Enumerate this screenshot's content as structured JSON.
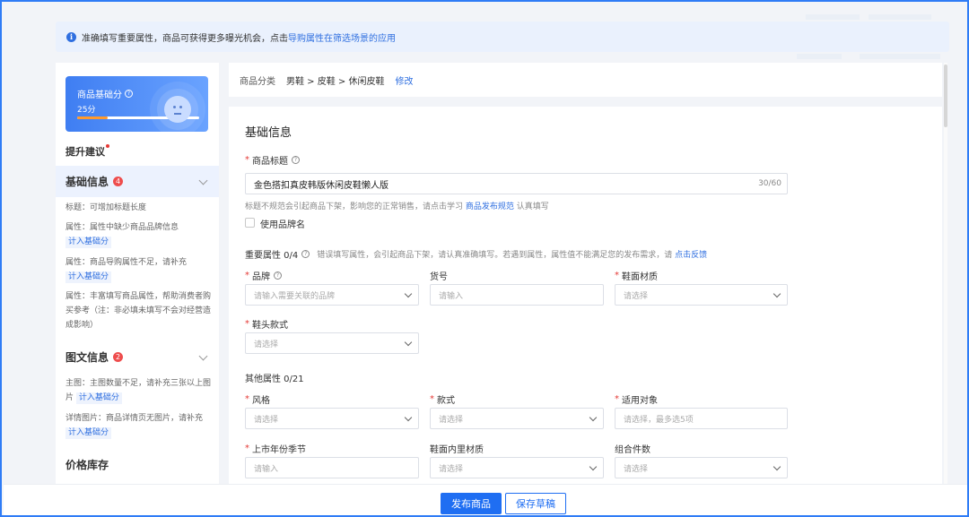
{
  "notice": {
    "text": "准确填写重要属性，商品可获得更多曝光机会，点击",
    "link": "导购属性在筛选场景的应用"
  },
  "sidebar": {
    "score_title": "商品基础分",
    "score_value": "25分",
    "score_progress": 0.25,
    "suggest_label": "提升建议",
    "sections": [
      {
        "title": "基础信息",
        "badge": "4",
        "items": [
          {
            "text": "标题：可增加标题长度"
          },
          {
            "text": "属性：属性中缺少商品品牌信息",
            "tag": "计入基础分"
          },
          {
            "text": "属性：商品导购属性不足，请补充",
            "tag": "计入基础分"
          },
          {
            "text": "属性：丰富填写商品属性，帮助消费者购买参考（注：非必填未填写不会对经营造成影响）"
          }
        ]
      },
      {
        "title": "图文信息",
        "badge": "2",
        "items": [
          {
            "text": "主图：主图数量不足，请补充三张以上图片",
            "tag": "计入基础分"
          },
          {
            "text": "详情图片：商品详情页无图片，请补充",
            "tag": "计入基础分"
          }
        ]
      },
      {
        "title": "价格库存"
      }
    ]
  },
  "category": {
    "label": "商品分类",
    "path": "男鞋 > 皮鞋 > 休闲皮鞋",
    "edit": "修改"
  },
  "form": {
    "section_title": "基础信息",
    "title_label": "商品标题",
    "title_value": "金色搭扣真皮韩版休闲皮鞋懒人版",
    "title_count": "30/60",
    "title_hint_pre": "标题不规范会引起商品下架，影响您的正常销售，请点击学习",
    "title_hint_link": "商品发布规范",
    "title_hint_post": "认真填写",
    "brand_checkbox": "使用品牌名",
    "important_title": "重要属性 0/4",
    "important_desc": "错误填写属性，会引起商品下架，请认真准确填写。若遇到属性，属性值不能满足您的发布需求，请",
    "important_link": "点击反馈",
    "brand_label": "品牌",
    "brand_placeholder": "请输入需要关联的品牌",
    "sku_label": "货号",
    "sku_placeholder": "请输入",
    "upper_label": "鞋面材质",
    "upper_placeholder": "请选择",
    "toe_label": "鞋头款式",
    "toe_placeholder": "请选择",
    "other_title": "其他属性 0/21",
    "style_label": "风格",
    "style_placeholder": "请选择",
    "type_label": "款式",
    "type_placeholder": "请选择",
    "target_label": "适用对象",
    "target_placeholder": "请选择，最多选5项",
    "season_label": "上市年份季节",
    "season_placeholder": "请输入",
    "lining_label": "鞋面内里材质",
    "lining_placeholder": "请选择",
    "combo_label": "组合件数",
    "combo_placeholder": "请选择"
  },
  "footer": {
    "publish": "发布商品",
    "save_draft": "保存草稿"
  },
  "colors": {
    "accent": "#1f6ef2",
    "required": "#e53935",
    "notice_bg": "#eaf1fd"
  }
}
